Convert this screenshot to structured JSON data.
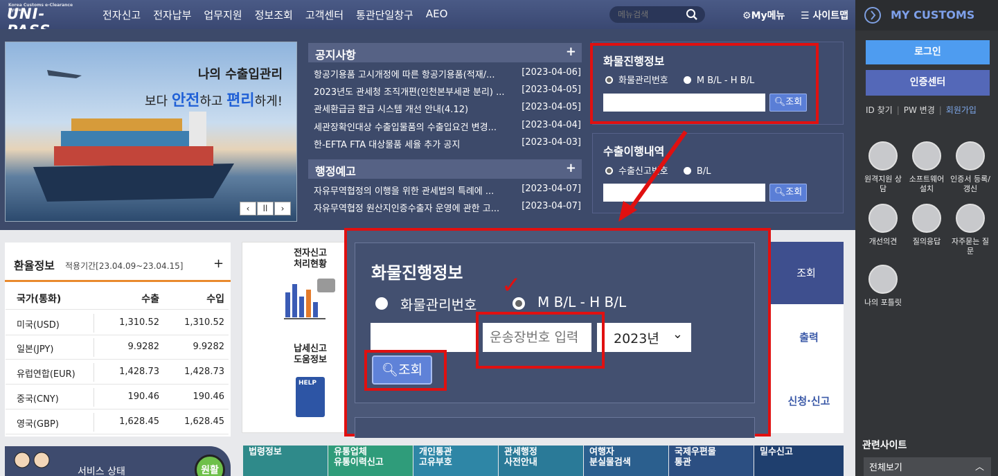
{
  "logo": {
    "text": "UNI-PASS",
    "sub": "Korea Customs e-Clearance System"
  },
  "nav": [
    "전자신고",
    "전자납부",
    "업무지원",
    "정보조회",
    "고객센터",
    "통관단일창구",
    "AEO"
  ],
  "search": {
    "placeholder": "메뉴검색"
  },
  "mymenu": "My메뉴",
  "sitemap": "사이트맵",
  "sidebar": {
    "title": "MY CUSTOMS",
    "login": "로그인",
    "cert": "인증센터",
    "links": [
      "ID 찾기",
      "PW 변경",
      "회원가입"
    ],
    "icons": [
      "원격지원 상담",
      "소프트웨어 설치",
      "인증서 등록/갱신",
      "개선의견",
      "질의응답",
      "자주묻는 질문",
      "나의 포틀릿"
    ],
    "related": "관련사이트",
    "viewall": "전체보기"
  },
  "banner": {
    "line1": "나의 수출입관리",
    "pre": "보다 ",
    "w1": "안전",
    "mid": "하고 ",
    "w2": "편리",
    "post": "하게!",
    "prev": "‹",
    "pause": "ll",
    "next": "›"
  },
  "notice": {
    "title": "공지사항",
    "items": [
      {
        "t": "항공기용품 고시개정에 따른 항공기용품(적재/...",
        "d": "[2023-04-06]"
      },
      {
        "t": "2023년도 관세청 조직개편(인천본부세관 분리) ...",
        "d": "[2023-04-05]"
      },
      {
        "t": "관세환급금 환급 시스템 개선 안내(4.12)",
        "d": "[2023-04-05]"
      },
      {
        "t": "세관장확인대상 수출입물품의 수출입요건 변경...",
        "d": "[2023-04-04]"
      },
      {
        "t": "한-EFTA FTA 대상물품 세율 추가 공지",
        "d": "[2023-04-03]"
      }
    ]
  },
  "admin": {
    "title": "행정예고",
    "items": [
      {
        "t": "자유무역협정의 이행을 위한 관세법의 특례에 ...",
        "d": "[2023-04-07]"
      },
      {
        "t": "자유무역협정 원산지인증수출자 운영에 관한 고...",
        "d": "[2023-04-07]"
      }
    ]
  },
  "cargo": {
    "title": "화물진행정보",
    "opt1": "화물관리번호",
    "opt2": "M B/L - H B/L",
    "btn": "조회"
  },
  "export": {
    "title": "수출이행내역",
    "opt1": "수출신고번호",
    "opt2": "B/L",
    "btn": "조회"
  },
  "fx": {
    "title": "환율정보",
    "period": "적용기간[23.04.09~23.04.15]",
    "headers": [
      "국가(통화)",
      "수출",
      "수입"
    ],
    "rows": [
      [
        "미국(USD)",
        "1,310.52",
        "1,310.52"
      ],
      [
        "일본(JPY)",
        "9.9282",
        "9.9282"
      ],
      [
        "유럽연합(EUR)",
        "1,428.73",
        "1,428.73"
      ],
      [
        "중국(CNY)",
        "190.46",
        "190.46"
      ],
      [
        "영국(GBP)",
        "1,628.45",
        "1,628.45"
      ]
    ]
  },
  "mid": {
    "l1": "전자신고\n처리현황",
    "l2": "납세신고\n도움정보",
    "help": "HELP"
  },
  "strip": {
    "top": "조회",
    "i1": "출력",
    "i2": "신청·신고"
  },
  "service": {
    "text": "서비스 상태",
    "ok": "원활"
  },
  "tiles": [
    {
      "t": "법령정보",
      "c": "#2f8a8a"
    },
    {
      "t": "유통업체\n유통이력신고",
      "c": "#2f9c7a"
    },
    {
      "t": "개인통관\n고유부호",
      "c": "#2e86a6"
    },
    {
      "t": "관세행정\n사전안내",
      "c": "#2a7a98"
    },
    {
      "t": "여행자\n분실물검색",
      "c": "#2b5f8e"
    },
    {
      "t": "국제우편물\n통관",
      "c": "#2c4f82"
    },
    {
      "t": "밀수신고",
      "c": "#1f3f6e"
    }
  ],
  "zoom": {
    "title": "화물진행정보",
    "opt1": "화물관리번호",
    "opt2": "M B/L - H B/L",
    "placeholder": "운송장번호 입력",
    "year": "2023년",
    "btn": "조회",
    "check": "✓"
  }
}
